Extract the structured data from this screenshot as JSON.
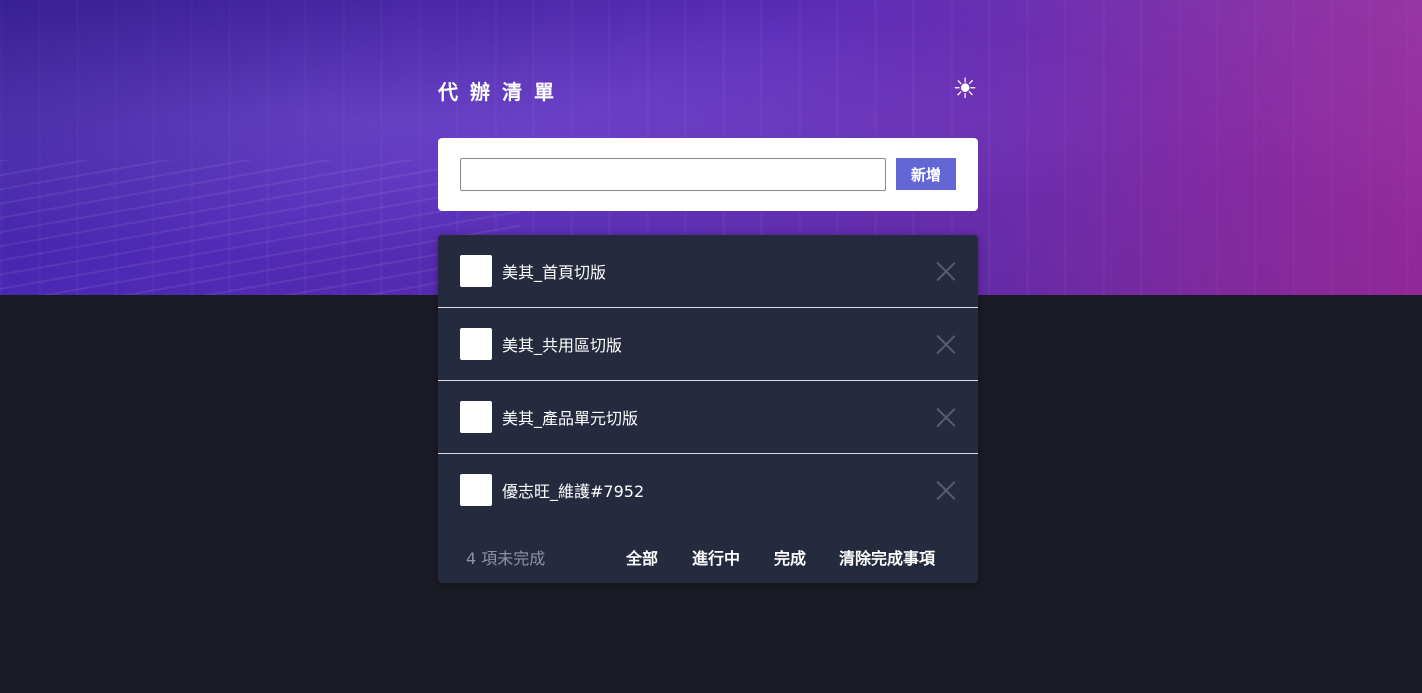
{
  "header": {
    "title": "代辦清單",
    "theme_icon": "sun-icon"
  },
  "add_form": {
    "input_value": "",
    "placeholder": "",
    "button_label": "新增",
    "button_color": "#6367d6"
  },
  "todos": [
    {
      "text": "美其_首頁切版",
      "done": false
    },
    {
      "text": "美其_共用區切版",
      "done": false
    },
    {
      "text": "美其_產品單元切版",
      "done": false
    },
    {
      "text": "優志旺_維護#7952",
      "done": false
    }
  ],
  "footer": {
    "remaining": "4 項未完成",
    "filters": [
      "全部",
      "進行中",
      "完成"
    ],
    "clear_label": "清除完成事項"
  },
  "colors": {
    "page_bg": "#1b1b25",
    "card_bg": "#252a3f",
    "accent": "#6367d6"
  }
}
